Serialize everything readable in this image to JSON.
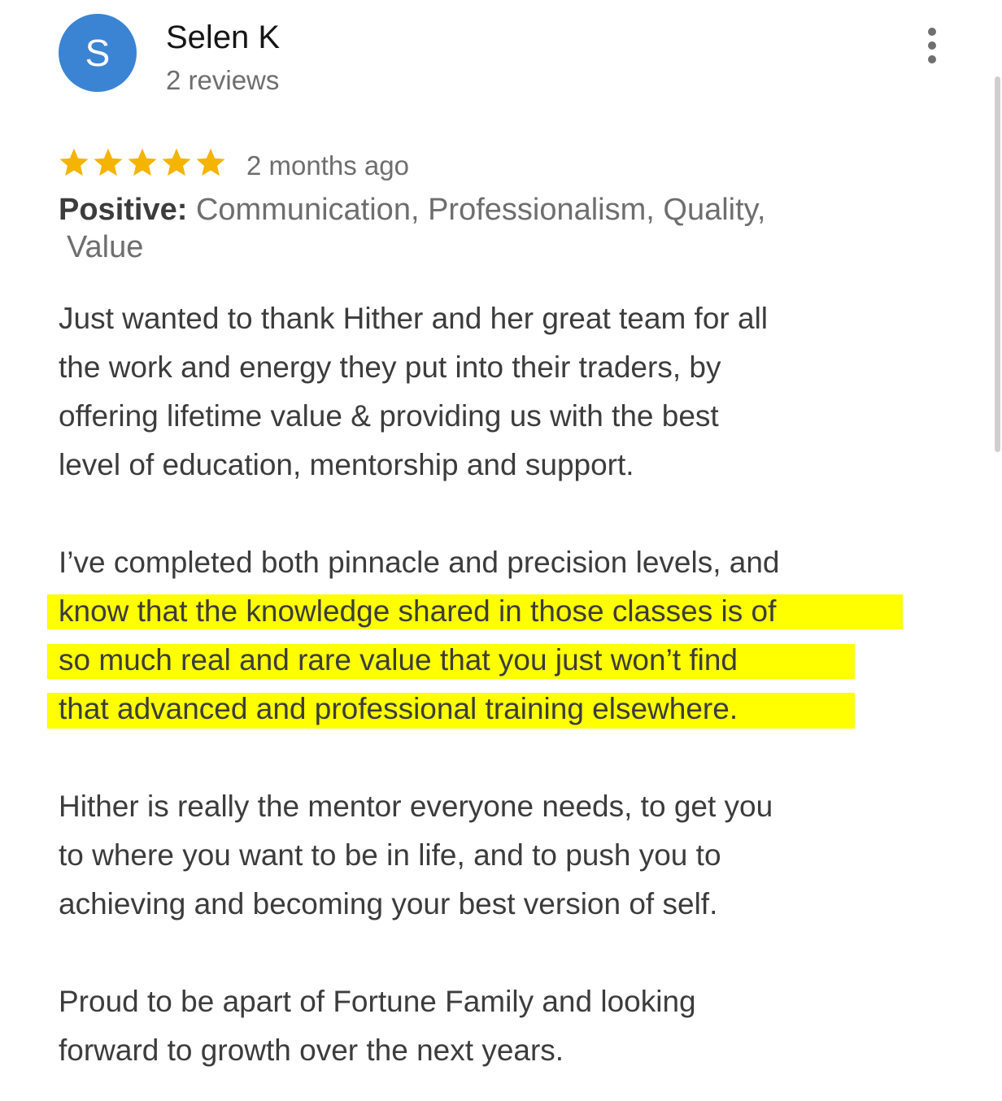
{
  "reviewer": {
    "avatar_initial": "S",
    "name": "Selen K",
    "review_count": "2 reviews"
  },
  "more_icon": "more-vert-icon",
  "rating": {
    "stars": 5,
    "max": 5,
    "star_color": "#f4b400",
    "date": "2 months ago"
  },
  "positive": {
    "label": "Positive:",
    "line1": "Communication, Professionalism, Quality,",
    "line2": "Value"
  },
  "highlight_color": "#ffff00",
  "review": {
    "p1": [
      "Just wanted to thank Hither and her great team for all",
      "the work and energy they put into their traders, by",
      "offering lifetime value & providing us with the best",
      "level of education, mentorship and support."
    ],
    "p2": [
      "I’ve completed both pinnacle and precision levels, and",
      "know that the knowledge shared in those classes is of",
      "so much real and rare value that you just won’t find",
      "that advanced and professional training elsewhere."
    ],
    "p3": [
      "Hither is really the mentor everyone needs, to get you",
      "to where you want to be in life, and to push you to",
      "achieving and becoming your best version of self."
    ],
    "p4": [
      "Proud to be apart of Fortune Family and looking",
      "forward to growth over the next years."
    ]
  }
}
